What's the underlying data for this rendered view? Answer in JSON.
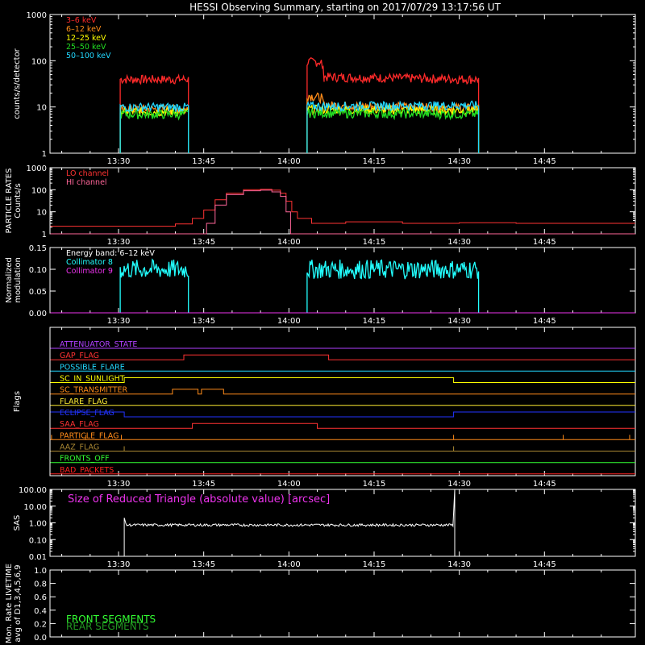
{
  "title": "HESSI Observing Summary, starting on 2017/07/29 13:17:56 UT",
  "colors": {
    "background": "#000000",
    "axes": "#ffffff",
    "e3_6": "#ff2a2a",
    "e6_12": "#ff8c1a",
    "e12_25": "#ffff00",
    "e25_50": "#22dd22",
    "e50_100": "#22d8ff",
    "lo": "#ff3333",
    "hi": "#ff6699",
    "coll8": "#22ffff",
    "coll9": "#ee33ee"
  },
  "time_ticks": [
    "13:30",
    "13:45",
    "14:00",
    "14:15",
    "14:30",
    "14:45"
  ],
  "time_tick_values": [
    30,
    45,
    60,
    75,
    90,
    105
  ],
  "time_minor_values": [
    20,
    25,
    35,
    40,
    50,
    55,
    65,
    70,
    80,
    85,
    95,
    100,
    110,
    115
  ],
  "time_range": [
    17.93,
    121.0
  ],
  "chart_data": [
    {
      "type": "line",
      "name": "count-rates",
      "ylabel": "counts/s/detector",
      "yscale": "log",
      "ylim": [
        1,
        1000
      ],
      "yticks": [
        "1",
        "10",
        "100",
        "1000"
      ],
      "x_units": "minutes after 13:00 UT",
      "series": [
        {
          "name": "3–6 keV",
          "color": "#ff2a2a",
          "segments": [
            {
              "x": [
                30.3,
                42.3
              ],
              "y": [
                40,
                40
              ]
            },
            {
              "x": [
                63.2,
                65.7,
                66.2,
                93.4
              ],
              "y": [
                95,
                95,
                45,
                40
              ]
            }
          ]
        },
        {
          "name": "6–12 keV",
          "color": "#ff8c1a",
          "segments": [
            {
              "x": [
                30.3,
                42.3
              ],
              "y": [
                9,
                9
              ]
            },
            {
              "x": [
                63.2,
                65.7,
                66.2,
                93.4
              ],
              "y": [
                18,
                16,
                11,
                9.5
              ]
            }
          ]
        },
        {
          "name": "12–25 keV",
          "color": "#ffff00",
          "segments": [
            {
              "x": [
                30.3,
                42.3
              ],
              "y": [
                8,
                8
              ]
            },
            {
              "x": [
                63.2,
                93.4
              ],
              "y": [
                9,
                8.5
              ]
            }
          ]
        },
        {
          "name": "25–50 keV",
          "color": "#22dd22",
          "segments": [
            {
              "x": [
                30.3,
                42.3
              ],
              "y": [
                7,
                7
              ]
            },
            {
              "x": [
                63.2,
                93.4
              ],
              "y": [
                7.5,
                7
              ]
            }
          ]
        },
        {
          "name": "50–100 keV",
          "color": "#22d8ff",
          "segments": [
            {
              "x": [
                30.3,
                42.3
              ],
              "y": [
                10,
                10
              ]
            },
            {
              "x": [
                63.2,
                93.4
              ],
              "y": [
                10.5,
                11
              ]
            }
          ]
        }
      ]
    },
    {
      "type": "line",
      "name": "particle-rates",
      "ylabel": "PARTICLE RATES\nCounts/s",
      "yscale": "log",
      "ylim": [
        1,
        1000
      ],
      "yticks": [
        "1",
        "10",
        "100",
        "1000"
      ],
      "series": [
        {
          "name": "LO channel",
          "color": "#ff3333",
          "x": [
            18,
            35,
            40,
            43,
            45,
            47,
            49,
            52,
            55,
            57,
            58.5,
            59.5,
            60.5,
            61.5,
            64,
            70,
            80,
            90,
            100,
            110,
            121
          ],
          "y": [
            2.2,
            2.2,
            2.8,
            5,
            12,
            35,
            70,
            100,
            105,
            95,
            70,
            30,
            10,
            5,
            3,
            3.5,
            3,
            3.2,
            3,
            3,
            3
          ]
        },
        {
          "name": "HI channel",
          "color": "#ff6699",
          "x": [
            18,
            44.5,
            45.5,
            47,
            49,
            52,
            55,
            57,
            58.5,
            59.5,
            60.3,
            121
          ],
          "y": [
            1,
            1,
            3,
            20,
            60,
            90,
            95,
            80,
            50,
            10,
            1,
            1
          ]
        }
      ]
    },
    {
      "type": "line",
      "name": "modulation",
      "ylabel": "Normalized\nmodulation",
      "ylim": [
        0,
        0.15
      ],
      "yticks": [
        "0.00",
        "0.05",
        "0.10",
        "0.15"
      ],
      "annotation": "Energy band: 6–12 keV",
      "series": [
        {
          "name": "Collimator 8",
          "color": "#22ffff",
          "segments": [
            {
              "x": [
                30.3,
                42.3
              ],
              "y": [
                0.1,
                0.1
              ]
            },
            {
              "x": [
                63.2,
                93.4
              ],
              "y": [
                0.1,
                0.1
              ]
            }
          ]
        },
        {
          "name": "Collimator 9",
          "color": "#ee33ee",
          "x": [
            18,
            121
          ],
          "y": [
            0,
            0
          ]
        }
      ]
    },
    {
      "type": "line",
      "name": "flags",
      "ylabel": "Flags",
      "flags": [
        {
          "name": "ATTENUATOR_STATE",
          "color": "#b040ff",
          "x": [
            18,
            121
          ],
          "y": [
            0,
            0
          ]
        },
        {
          "name": "GAP_FLAG",
          "color": "#ff3333",
          "x": [
            18,
            41.5,
            41.5,
            67,
            67,
            121
          ],
          "y": [
            0,
            0,
            1,
            1,
            0,
            0
          ]
        },
        {
          "name": "POSSIBLE_FLARE",
          "color": "#22d8ff",
          "x": [
            18,
            121
          ],
          "y": [
            0,
            0
          ]
        },
        {
          "name": "SC_IN_SUNLIGHT",
          "color": "#ffff00",
          "x": [
            18,
            31,
            31,
            89,
            89,
            121
          ],
          "y": [
            0,
            0,
            1,
            1,
            0,
            0
          ]
        },
        {
          "name": "SC_TRANSMITTER",
          "color": "#ff8c1a",
          "x": [
            18,
            39.5,
            39.5,
            44,
            44,
            44.6,
            44.6,
            48.5,
            48.5,
            121
          ],
          "y": [
            0,
            0,
            1,
            1,
            0,
            0,
            1,
            1,
            0,
            0
          ]
        },
        {
          "name": "FLARE_FLAG",
          "color": "#ffee33",
          "x": [
            18,
            121
          ],
          "y": [
            0,
            0
          ]
        },
        {
          "name": "ECLIPSE_FLAG",
          "color": "#2233ff",
          "x": [
            18,
            31,
            31,
            89,
            89,
            121
          ],
          "y": [
            1,
            1,
            0,
            0,
            1,
            1
          ]
        },
        {
          "name": "SAA_FLAG",
          "color": "#ff3333",
          "x": [
            18,
            43,
            43,
            65,
            65,
            121
          ],
          "y": [
            0,
            0,
            1,
            1,
            0,
            0
          ]
        },
        {
          "name": "PARTICLE_FLAG",
          "color": "#ff8c1a",
          "x": [
            18,
            121
          ],
          "y": [
            0,
            0
          ],
          "spikes": [
            18.2,
            24.2,
            30.5,
            89,
            108.3,
            120
          ]
        },
        {
          "name": "AAZ_FLAG",
          "color": "#aa8833",
          "x": [
            18,
            121
          ],
          "y": [
            0,
            0
          ],
          "spikes": [
            31,
            89
          ]
        },
        {
          "name": "FRONTS_OFF",
          "color": "#33ff33",
          "x": [
            18,
            121
          ],
          "y": [
            0,
            0
          ]
        },
        {
          "name": "BAD_PACKETS",
          "color": "#ff2222",
          "x": [
            18,
            121
          ],
          "y": [
            0,
            0
          ]
        }
      ]
    },
    {
      "type": "line",
      "name": "sas",
      "ylabel": "SAS",
      "yscale": "log",
      "ylim": [
        0.01,
        100
      ],
      "yticks": [
        "0.01",
        "0.10",
        "1.00",
        "10.00",
        "100.00"
      ],
      "annotation": "Size of Reduced Triangle (absolute value) [arcsec]",
      "series": [
        {
          "name": "",
          "color": "#ffffff",
          "x": [
            31,
            31.3,
            89,
            89.2
          ],
          "y": [
            0.01,
            0.75,
            0.65,
            100
          ]
        }
      ]
    },
    {
      "type": "line",
      "name": "livetime",
      "ylabel": "Mon. Rate LIVETIME\navg of D1,3,4,5,6,9",
      "ylim": [
        0,
        1
      ],
      "yticks": [
        "0.0",
        "0.2",
        "0.4",
        "0.6",
        "0.8",
        "1.0"
      ],
      "series": [
        {
          "name": "FRONT SEGMENTS",
          "color": "#33ff33",
          "x": [],
          "y": []
        },
        {
          "name": "REAR SEGMENTS",
          "color": "#229922",
          "x": [],
          "y": []
        }
      ]
    }
  ]
}
